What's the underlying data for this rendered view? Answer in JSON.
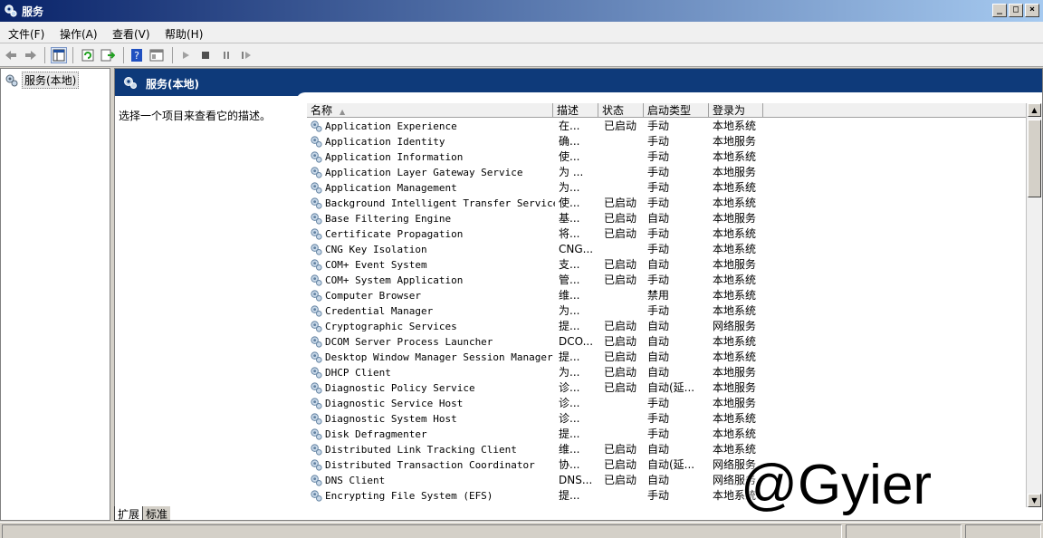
{
  "window": {
    "title": "服务",
    "icon": "gear-icon"
  },
  "menu": [
    "文件(F)",
    "操作(A)",
    "查看(V)",
    "帮助(H)"
  ],
  "toolbar": {
    "icons": [
      "back-icon",
      "forward-icon",
      "show-hide-tree-icon",
      "refresh-icon",
      "export-list-icon",
      "help-icon",
      "properties-icon",
      "start-service-icon",
      "stop-service-icon",
      "pause-service-icon",
      "restart-service-icon"
    ]
  },
  "tree": {
    "root_label": "服务(本地)"
  },
  "header": {
    "title": "服务(本地)"
  },
  "description_pane": {
    "text": "选择一个项目来查看它的描述。"
  },
  "columns": [
    "名称",
    "描述",
    "状态",
    "启动类型",
    "登录为"
  ],
  "rows": [
    {
      "name": "Application Experience",
      "desc": "在...",
      "status": "已启动",
      "startup": "手动",
      "logon": "本地系统"
    },
    {
      "name": "Application Identity",
      "desc": "确...",
      "status": "",
      "startup": "手动",
      "logon": "本地服务"
    },
    {
      "name": "Application Information",
      "desc": "使...",
      "status": "",
      "startup": "手动",
      "logon": "本地系统"
    },
    {
      "name": "Application Layer Gateway Service",
      "desc": "为 ...",
      "status": "",
      "startup": "手动",
      "logon": "本地服务"
    },
    {
      "name": "Application Management",
      "desc": "为...",
      "status": "",
      "startup": "手动",
      "logon": "本地系统"
    },
    {
      "name": "Background Intelligent Transfer Service",
      "desc": "使...",
      "status": "已启动",
      "startup": "手动",
      "logon": "本地系统"
    },
    {
      "name": "Base Filtering Engine",
      "desc": "基...",
      "status": "已启动",
      "startup": "自动",
      "logon": "本地服务"
    },
    {
      "name": "Certificate Propagation",
      "desc": "将...",
      "status": "已启动",
      "startup": "手动",
      "logon": "本地系统"
    },
    {
      "name": "CNG Key Isolation",
      "desc": "CNG...",
      "status": "",
      "startup": "手动",
      "logon": "本地系统"
    },
    {
      "name": "COM+ Event System",
      "desc": "支...",
      "status": "已启动",
      "startup": "自动",
      "logon": "本地服务"
    },
    {
      "name": "COM+ System Application",
      "desc": "管...",
      "status": "已启动",
      "startup": "手动",
      "logon": "本地系统"
    },
    {
      "name": "Computer Browser",
      "desc": "维...",
      "status": "",
      "startup": "禁用",
      "logon": "本地系统"
    },
    {
      "name": "Credential Manager",
      "desc": "为...",
      "status": "",
      "startup": "手动",
      "logon": "本地系统"
    },
    {
      "name": "Cryptographic Services",
      "desc": "提...",
      "status": "已启动",
      "startup": "自动",
      "logon": "网络服务"
    },
    {
      "name": "DCOM Server Process Launcher",
      "desc": "DCO...",
      "status": "已启动",
      "startup": "自动",
      "logon": "本地系统"
    },
    {
      "name": "Desktop Window Manager Session Manager",
      "desc": "提...",
      "status": "已启动",
      "startup": "自动",
      "logon": "本地系统"
    },
    {
      "name": "DHCP Client",
      "desc": "为...",
      "status": "已启动",
      "startup": "自动",
      "logon": "本地服务"
    },
    {
      "name": "Diagnostic Policy Service",
      "desc": "诊...",
      "status": "已启动",
      "startup": "自动(延...",
      "logon": "本地服务"
    },
    {
      "name": "Diagnostic Service Host",
      "desc": "诊...",
      "status": "",
      "startup": "手动",
      "logon": "本地服务"
    },
    {
      "name": "Diagnostic System Host",
      "desc": "诊...",
      "status": "",
      "startup": "手动",
      "logon": "本地系统"
    },
    {
      "name": "Disk Defragmenter",
      "desc": "提...",
      "status": "",
      "startup": "手动",
      "logon": "本地系统"
    },
    {
      "name": "Distributed Link Tracking Client",
      "desc": "维...",
      "status": "已启动",
      "startup": "自动",
      "logon": "本地系统"
    },
    {
      "name": "Distributed Transaction Coordinator",
      "desc": "协...",
      "status": "已启动",
      "startup": "自动(延...",
      "logon": "网络服务"
    },
    {
      "name": "DNS Client",
      "desc": "DNS...",
      "status": "已启动",
      "startup": "自动",
      "logon": "网络服务"
    },
    {
      "name": "Encrypting File System (EFS)",
      "desc": "提...",
      "status": "",
      "startup": "手动",
      "logon": "本地系统"
    }
  ],
  "tabs": [
    "扩展",
    "标准"
  ],
  "watermark": "@Gyier"
}
